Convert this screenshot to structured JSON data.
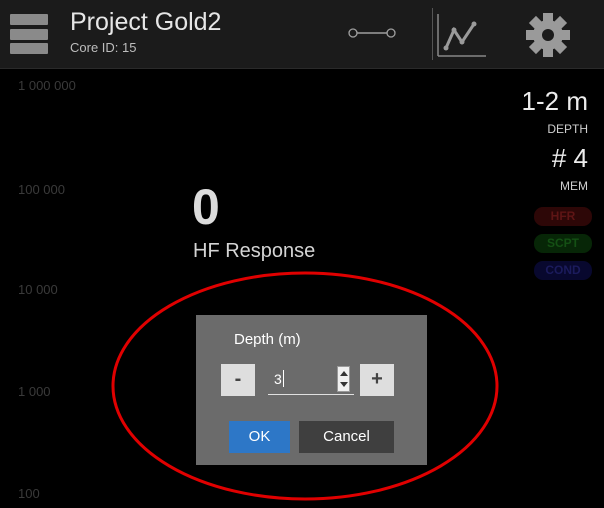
{
  "header": {
    "title": "Project Gold2",
    "subtitle": "Core ID: 15",
    "icons": [
      "menu-icon",
      "connection-icon",
      "chart-icon",
      "gear-icon"
    ]
  },
  "axis": {
    "ticks": [
      "1 000 000",
      "100 000",
      "10 000",
      "1 000",
      "100"
    ]
  },
  "readout": {
    "value": "0",
    "label": "HF Response"
  },
  "status": {
    "depth_value": "1-2 m",
    "depth_label": "DEPTH",
    "mem_value": "# 4",
    "mem_label": "MEM",
    "modes": [
      "HFR",
      "SCPT",
      "COND"
    ]
  },
  "dialog": {
    "title": "Depth (m)",
    "minus_label": "-",
    "plus_label": "+",
    "input_value": "3",
    "ok_label": "OK",
    "cancel_label": "Cancel"
  },
  "colors": {
    "background": "#000000",
    "header": "#1b1b1b",
    "dialog": "#6b6b6b",
    "ok_button": "#2d77c7",
    "annotation": "#e00000"
  }
}
